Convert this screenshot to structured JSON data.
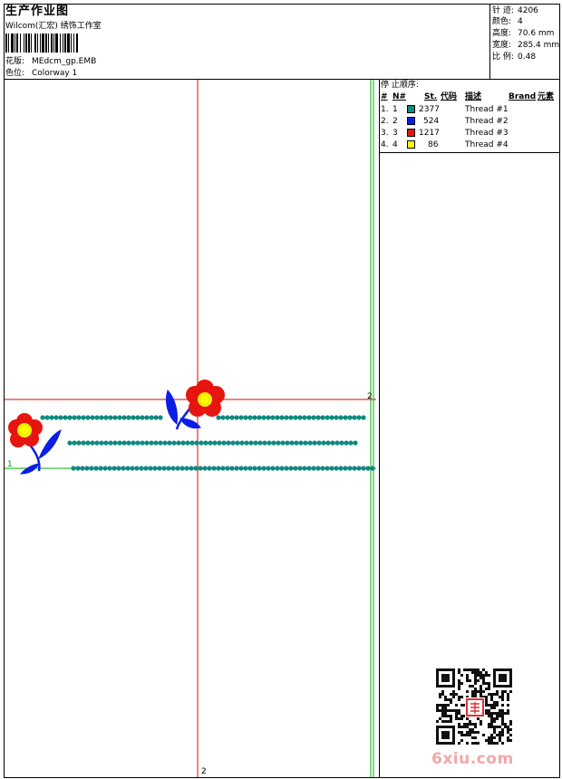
{
  "header": {
    "title": "生产作业图",
    "subtitle": "Wilcom(汇宏) 绣饰工作室",
    "design_label": "花版:",
    "design_value": "MEdcm_gp.EMB",
    "colorway_label": "色位:",
    "colorway_value": "Colorway 1"
  },
  "stats": [
    {
      "label": "针 迹:",
      "value": "4206"
    },
    {
      "label": "颜色:",
      "value": "4"
    },
    {
      "label": "高度:",
      "value": "70.6 mm"
    },
    {
      "label": "宽度:",
      "value": "285.4 mm"
    },
    {
      "label": "比 例:",
      "value": "0.48"
    }
  ],
  "stop_sequence": {
    "title": "停 止顺序:",
    "columns": [
      "#",
      "N#",
      "St.",
      "代码",
      "描述",
      "Brand",
      "元素"
    ],
    "rows": [
      {
        "idx": "1.",
        "n": "1",
        "stitches": "2377",
        "color": "#0e8a7e",
        "desc": "Thread #1"
      },
      {
        "idx": "2.",
        "n": "2",
        "stitches": "524",
        "color": "#0a1ee6",
        "desc": "Thread #2"
      },
      {
        "idx": "3.",
        "n": "3",
        "stitches": "1217",
        "color": "#e6150f",
        "desc": "Thread #3"
      },
      {
        "idx": "4.",
        "n": "4",
        "stitches": "86",
        "color": "#ffff00",
        "desc": "Thread #4"
      }
    ]
  },
  "guides": {
    "label_top_right": "2",
    "label_bottom": "2",
    "label_left": "1"
  },
  "watermark": "6xiu.com",
  "colors": {
    "teal": "#0e8a7e",
    "blue": "#0a1ee6",
    "red": "#e6150f",
    "yellow": "#ffff00",
    "guide_red": "#e00000",
    "guide_green": "#00b000"
  }
}
